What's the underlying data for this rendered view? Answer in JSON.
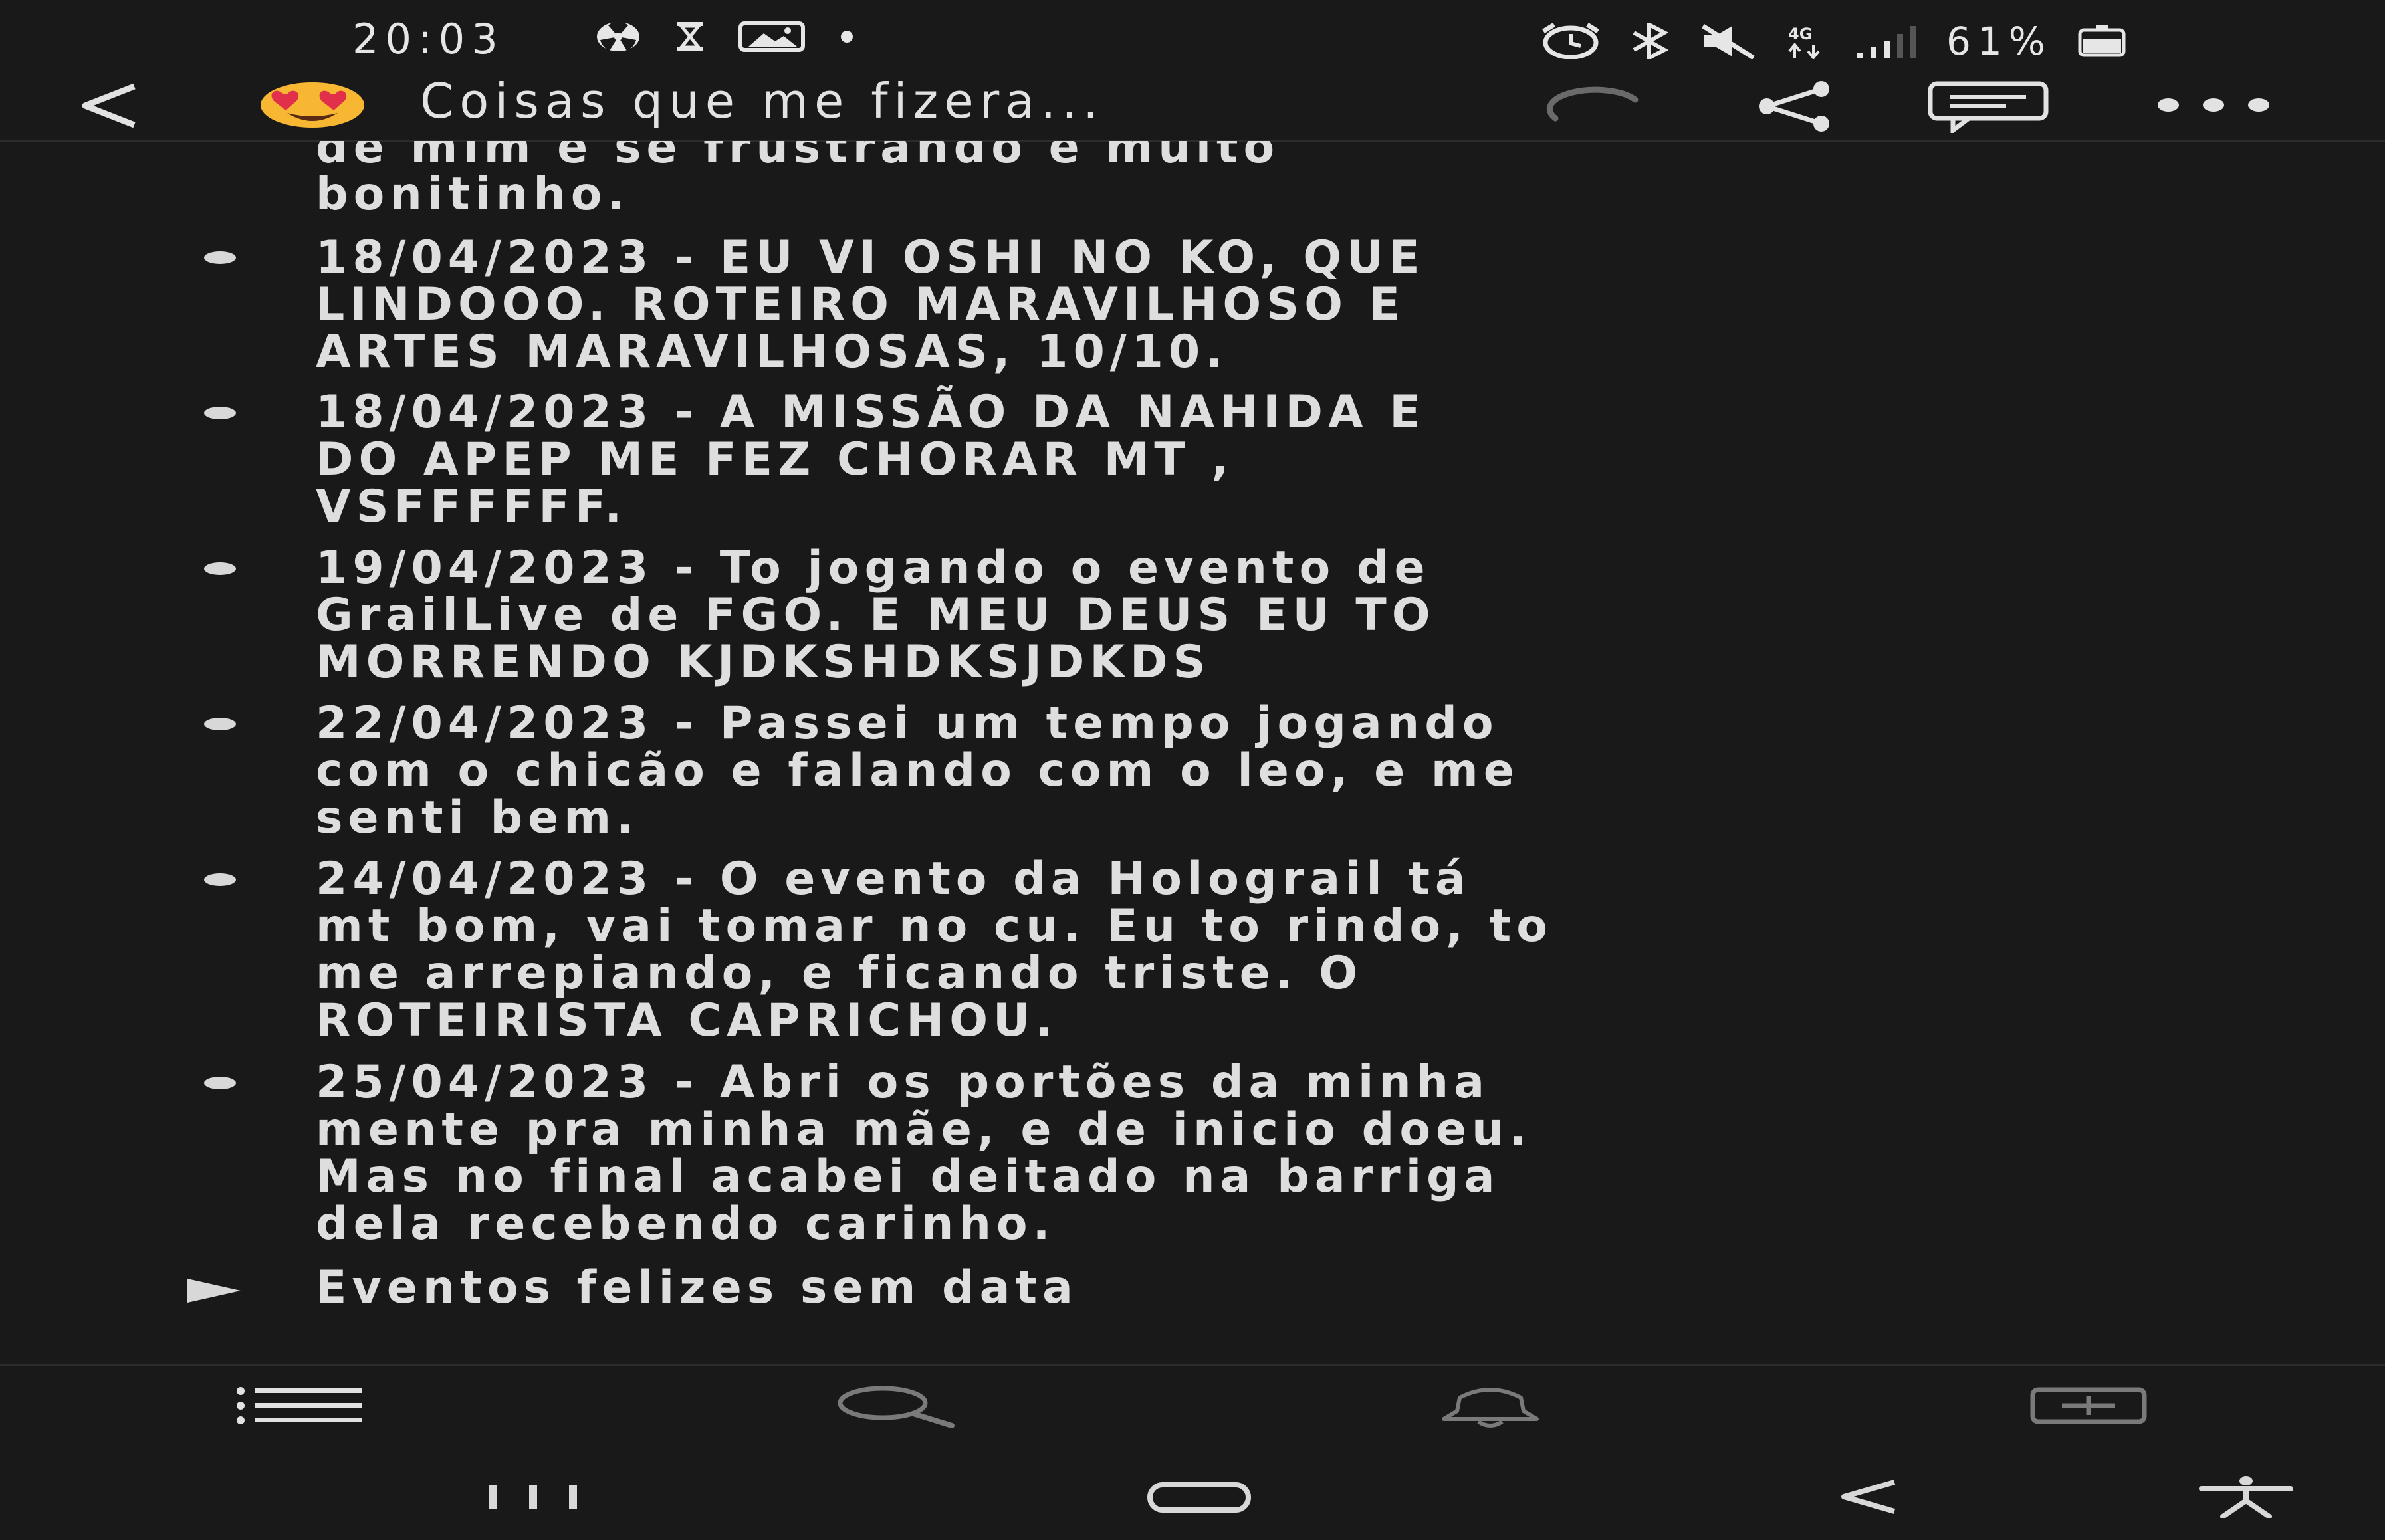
{
  "status_bar": {
    "time": "20:03",
    "battery_percent": "61%",
    "left_icons": [
      "radiation-icon",
      "hourglass-icon",
      "image-icon",
      "dot-icon"
    ],
    "right_icons": [
      "alarm-icon",
      "bluetooth-icon",
      "mute-icon",
      "data-4g-icon",
      "signal-icon",
      "battery-icon"
    ]
  },
  "app_bar": {
    "title": "Coisas que me fizera...",
    "emoji": "heart-eyes-emoji",
    "actions": [
      "sync-icon",
      "share-icon",
      "comment-icon",
      "more-icon"
    ]
  },
  "content": {
    "partial_text": "de mim e se frustrando é muito\nbonitinho.",
    "entries": [
      {
        "text": "18/04/2023 - EU VI OSHI NO KO, QUE\nLINDOOO. ROTEIRO MARAVILHOSO E\nARTES MARAVILHOSAS, 10/10."
      },
      {
        "text": "18/04/2023 - A MISSÃO DA NAHIDA E\nDO APEP ME FEZ CHORAR MT ,\nVSFFFFFF."
      },
      {
        "text": "19/04/2023 - To jogando o evento de\nGrailLive de FGO. E MEU DEUS EU TO\nMORRENDO KJDKSHDKSJDKDS"
      },
      {
        "text": "22/04/2023 - Passei um tempo jogando\ncom o chicão e falando com o leo, e me\nsenti bem."
      },
      {
        "text": "24/04/2023 - O evento da Holograil tá\nmt bom, vai tomar no cu. Eu to rindo, to\nme arrepiando, e ficando triste. O\nROTEIRISTA CAPRICHOU."
      },
      {
        "text": "25/04/2023 - Abri os portões da minha\nmente pra minha mãe, e de inicio doeu.\nMas no final acabei deitado na barriga\ndela recebendo carinho."
      }
    ],
    "collapsed_section": "Eventos felizes sem data"
  },
  "toolbar": {
    "items": [
      "list-icon",
      "search-icon",
      "notification-icon",
      "add-icon"
    ]
  },
  "nav_bar": {
    "items": [
      "recents-icon",
      "home-icon",
      "back-icon",
      "accessibility-icon"
    ]
  },
  "colors": {
    "background": "#191919",
    "text": "#dedede",
    "divider": "#2c2c2c",
    "emoji_face": "#f7b733",
    "emoji_heart": "#e0304a"
  }
}
